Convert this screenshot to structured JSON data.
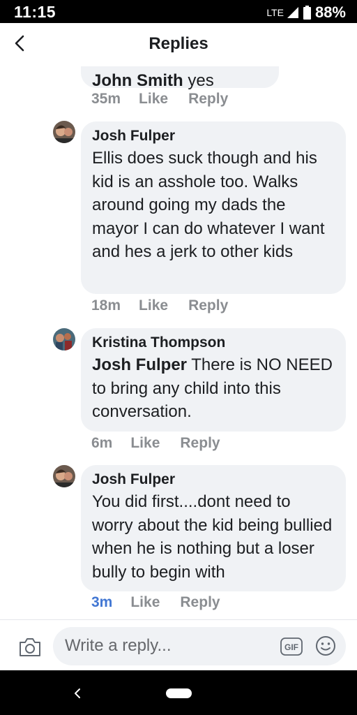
{
  "status_bar": {
    "time": "11:15",
    "network": "LTE",
    "battery": "88%"
  },
  "header": {
    "title": "Replies"
  },
  "comments": [
    {
      "author": "John Smith",
      "text": "yes",
      "time": "35m",
      "like": "Like",
      "reply": "Reply"
    },
    {
      "author": "Josh Fulper",
      "text": "Ellis does suck though and his kid is an asshole too. Walks around going my dads the mayor I can do whatever I want and hes a jerk to other kids",
      "time": "18m",
      "like": "Like",
      "reply": "Reply"
    },
    {
      "author": "Kristina Thompson",
      "mention": "Josh Fulper",
      "text": "There is NO NEED to bring any child into this conversation.",
      "time": "6m",
      "like": "Like",
      "reply": "Reply"
    },
    {
      "author": "Josh Fulper",
      "text": "You did first....dont need to worry about the kid being bullied when he is nothing but a loser bully to begin with",
      "time": "3m",
      "like": "Like",
      "reply": "Reply"
    }
  ],
  "reply_box": {
    "placeholder": "Write a reply...",
    "gif_label": "GIF"
  },
  "icons": {
    "back": "chevron-left-icon",
    "camera": "camera-icon",
    "gif": "gif-icon",
    "emoji": "smile-icon"
  },
  "colors": {
    "bubble": "#f0f2f5",
    "meta": "#8a8d91",
    "recent_time": "#4277d3"
  }
}
